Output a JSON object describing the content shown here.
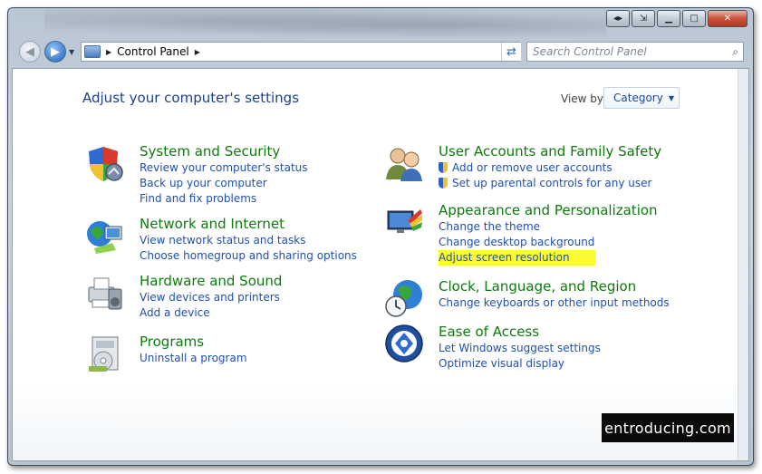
{
  "window": {
    "caption_icons": [
      "switch-icon",
      "snap-icon",
      "minimize-icon",
      "maximize-icon",
      "close-icon"
    ]
  },
  "navigation": {
    "breadcrumb": [
      "Control Panel"
    ],
    "search_placeholder": "Search Control Panel"
  },
  "header": {
    "title": "Adjust your computer's settings",
    "view_by_label": "View by:",
    "view_by_value": "Category"
  },
  "categories_left": [
    {
      "title": "System and Security",
      "icon": "shield-icon",
      "links": [
        "Review your computer's status",
        "Back up your computer",
        "Find and fix problems"
      ]
    },
    {
      "title": "Network and Internet",
      "icon": "network-icon",
      "links": [
        "View network status and tasks",
        "Choose homegroup and sharing options"
      ]
    },
    {
      "title": "Hardware and Sound",
      "icon": "printer-icon",
      "links": [
        "View devices and printers",
        "Add a device"
      ]
    },
    {
      "title": "Programs",
      "icon": "programs-icon",
      "links": [
        "Uninstall a program"
      ]
    }
  ],
  "categories_right": [
    {
      "title": "User Accounts and Family Safety",
      "icon": "users-icon",
      "links": [
        "Add or remove user accounts",
        "Set up parental controls for any user"
      ]
    },
    {
      "title": "Appearance and Personalization",
      "icon": "appearance-icon",
      "links": [
        "Change the theme",
        "Change desktop background",
        "Adjust screen resolution"
      ]
    },
    {
      "title": "Clock, Language, and Region",
      "icon": "clock-globe-icon",
      "links": [
        "Change keyboards or other input methods"
      ]
    },
    {
      "title": "Ease of Access",
      "icon": "ease-of-access-icon",
      "links": [
        "Let Windows suggest settings",
        "Optimize visual display"
      ]
    }
  ],
  "watermark": "entroducing.com",
  "colors": {
    "category_title": "#0e7a0d",
    "link": "#1f4fb4",
    "heading": "#1e3f8a",
    "highlight": "#fbfb33"
  }
}
